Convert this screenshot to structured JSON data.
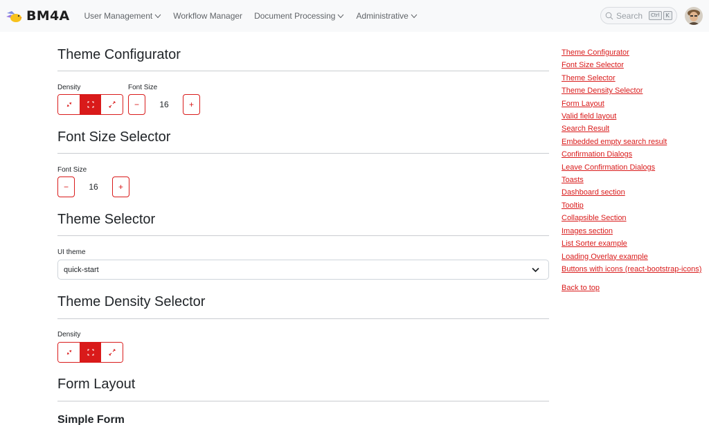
{
  "brand": {
    "name": "BM4A"
  },
  "nav": {
    "items": [
      {
        "label": "User Management",
        "dropdown": true
      },
      {
        "label": "Workflow Manager",
        "dropdown": false
      },
      {
        "label": "Document Processing",
        "dropdown": true
      },
      {
        "label": "Administrative",
        "dropdown": true
      }
    ]
  },
  "search": {
    "label": "Search",
    "shortcut_ctrl": "Ctrl",
    "shortcut_key": "K"
  },
  "colors": {
    "accent": "#d91a1a",
    "navbar_bg": "#f8f9fa"
  },
  "sections": {
    "theme_configurator": {
      "title": "Theme Configurator",
      "density_label": "Density",
      "font_size_label": "Font Size",
      "font_size_value": "16",
      "density_selected": "normal"
    },
    "font_size_selector": {
      "title": "Font Size Selector",
      "font_size_label": "Font Size",
      "font_size_value": "16"
    },
    "theme_selector": {
      "title": "Theme Selector",
      "ui_theme_label": "UI theme",
      "ui_theme_value": "quick-start"
    },
    "theme_density_selector": {
      "title": "Theme Density Selector",
      "density_label": "Density",
      "density_selected": "normal"
    },
    "form_layout": {
      "title": "Form Layout",
      "subtitle": "Simple Form"
    }
  },
  "stepper": {
    "decrement": "−",
    "increment": "+"
  },
  "toc": {
    "links": [
      "Theme Configurator",
      "Font Size Selector",
      "Theme Selector",
      "Theme Density Selector",
      "Form Layout",
      "Valid field layout",
      "Search Result",
      "Embedded empty search result",
      "Confirmation Dialogs",
      "Leave Confirmation Dialogs",
      "Toasts",
      "Dashboard section",
      "Tooltip",
      "Collapsible Section",
      "Images section",
      "List Sorter example",
      "Loading Overlay example",
      "Buttons with icons (react-bootstrap-icons)"
    ],
    "back_to_top": "Back to top"
  },
  "icons": {
    "logo": "bm4a-logo-icon",
    "search": "search-icon",
    "chevron": "chevron-down-icon",
    "density_compact": "arrows-collapse-icon",
    "density_normal": "fullscreen-icon",
    "density_spacious": "arrows-expand-icon"
  }
}
